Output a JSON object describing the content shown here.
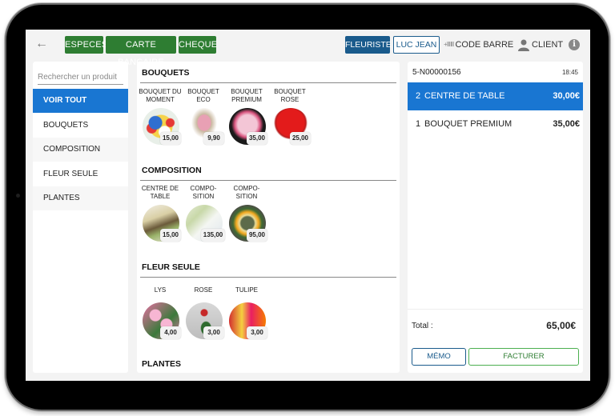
{
  "topbar": {
    "back_icon": "arrow-left-icon",
    "payment_buttons": [
      "ESPECES",
      "CARTE BANCAIRE",
      "CHEQUE"
    ],
    "role_button": "FLEURISTE",
    "user_button": "LUC JEAN",
    "barcode_label": "CODE BARRE",
    "barcode_icon": "+ⅡⅡⅡ",
    "client_label": "CLIENT",
    "info_icon": "i"
  },
  "sidebar": {
    "search_placeholder": "Rechercher un produit",
    "categories": [
      {
        "label": "VOIR TOUT",
        "active": true
      },
      {
        "label": "BOUQUETS",
        "active": false
      },
      {
        "label": "COMPOSITION",
        "active": false
      },
      {
        "label": "FLEUR SEULE",
        "active": false
      },
      {
        "label": "PLANTES",
        "active": false
      }
    ]
  },
  "products": {
    "sections": [
      {
        "title": "BOUQUETS",
        "items": [
          {
            "name": "BOUQUET DU MOMENT",
            "price": "15,00"
          },
          {
            "name": "BOUQUET ECO",
            "price": "9,90"
          },
          {
            "name": "BOUQUET PREMIUM",
            "price": "35,00"
          },
          {
            "name": "BOUQUET ROSE",
            "price": "25,00"
          }
        ]
      },
      {
        "title": "COMPOSITION",
        "items": [
          {
            "name": "CENTRE DE TABLE",
            "price": "15,00"
          },
          {
            "name": "COMPO-SITION",
            "price": "135,00"
          },
          {
            "name": "COMPO-SITION",
            "price": "95,00"
          }
        ]
      },
      {
        "title": "FLEUR SEULE",
        "items": [
          {
            "name": "LYS",
            "price": "4,00"
          },
          {
            "name": "ROSE",
            "price": "3,00"
          },
          {
            "name": "TULIPE",
            "price": "3,00"
          }
        ]
      },
      {
        "title": "PLANTES",
        "items": []
      }
    ]
  },
  "ticket": {
    "number": "5-N00000156",
    "time": "18:45",
    "lines": [
      {
        "qty": "2",
        "name": "CENTRE DE TABLE",
        "price": "30,00€",
        "selected": true
      },
      {
        "qty": "1",
        "name": "BOUQUET PREMIUM",
        "price": "35,00€",
        "selected": false
      }
    ],
    "total_label": "Total :",
    "total_value": "65,00€",
    "memo_button": "MÉMO",
    "invoice_button": "FACTURER"
  },
  "colors": {
    "payment_green": "#2e7d32",
    "primary_blue": "#1976d2",
    "dark_blue": "#1a5b8c"
  }
}
